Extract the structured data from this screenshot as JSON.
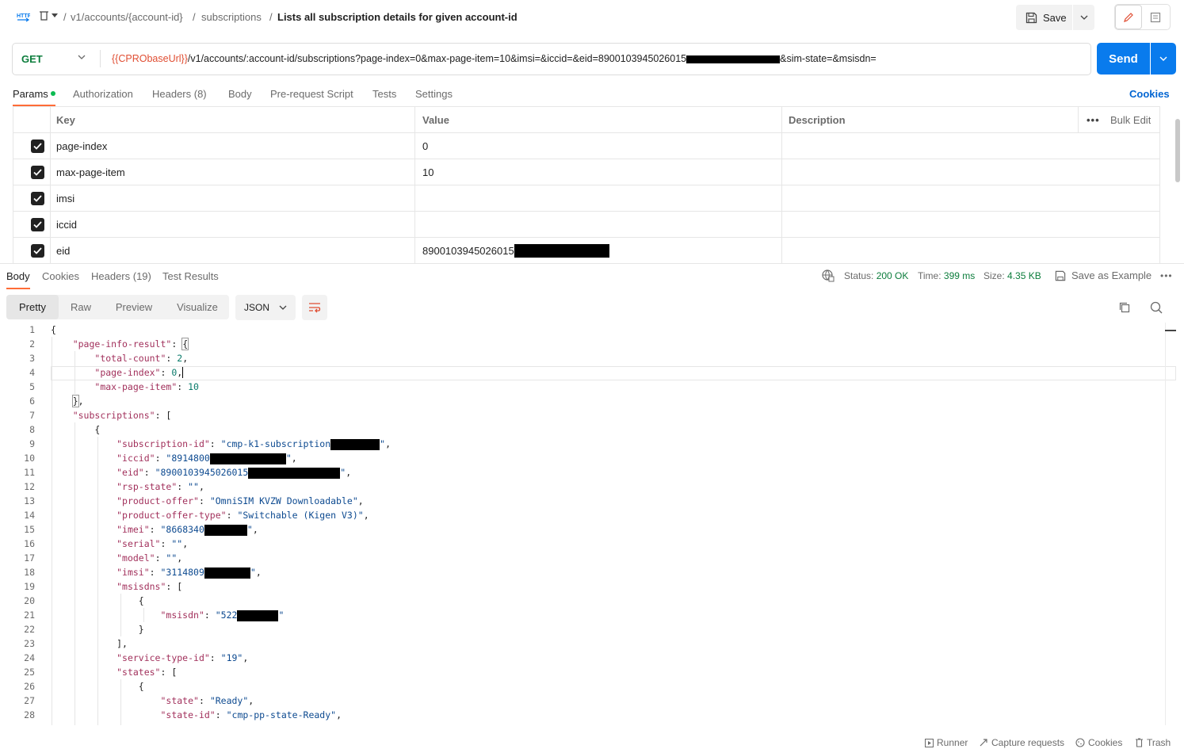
{
  "breadcrumb": {
    "part1": "v1/accounts/{account-id}",
    "part2": "subscriptions",
    "current": "Lists all subscription details for given account-id"
  },
  "toolbar": {
    "save_label": "Save"
  },
  "request": {
    "method": "GET",
    "url_variable": "{{CPRObaseUrl}}",
    "url_rest": "/v1/accounts/:account-id/subscriptions?page-index=0&max-page-item=10&imsi=&iccid=&eid=8900103945026015",
    "url_tail": "&sim-state=&msisdn=",
    "send_label": "Send"
  },
  "request_tabs": [
    "Params",
    "Authorization",
    "Headers (8)",
    "Body",
    "Pre-request Script",
    "Tests",
    "Settings"
  ],
  "cookies_link": "Cookies",
  "params_table": {
    "headers": {
      "key": "Key",
      "value": "Value",
      "description": "Description",
      "bulk_edit": "Bulk Edit"
    },
    "rows": [
      {
        "key": "page-index",
        "value": "0",
        "checked": true
      },
      {
        "key": "max-page-item",
        "value": "10",
        "checked": true
      },
      {
        "key": "imsi",
        "value": "",
        "checked": true
      },
      {
        "key": "iccid",
        "value": "",
        "checked": true
      },
      {
        "key": "eid",
        "value": "8900103945026015",
        "checked": true
      }
    ]
  },
  "response_tabs": [
    "Body",
    "Cookies",
    "Headers (19)",
    "Test Results"
  ],
  "response_status": {
    "status_label": "Status:",
    "status": "200 OK",
    "time_label": "Time:",
    "time": "399 ms",
    "size_label": "Size:",
    "size": "4.35 KB",
    "save_example": "Save as Example"
  },
  "view_modes": [
    "Pretty",
    "Raw",
    "Preview",
    "Visualize"
  ],
  "format": "JSON",
  "code_lines": [
    "1",
    "2",
    "3",
    "4",
    "5",
    "6",
    "7",
    "8",
    "9",
    "10",
    "11",
    "12",
    "13",
    "14",
    "15",
    "16",
    "17",
    "18",
    "19",
    "20",
    "21",
    "22",
    "23",
    "24",
    "25",
    "26",
    "27",
    "28"
  ],
  "json": {
    "page_info_key": "\"page-info-result\"",
    "total_count_key": "\"total-count\"",
    "total_count": "2",
    "page_index_key": "\"page-index\"",
    "page_index": "0",
    "max_page_item_key": "\"max-page-item\"",
    "max_page_item": "10",
    "subscriptions_key": "\"subscriptions\"",
    "subscription_id_key": "\"subscription-id\"",
    "subscription_id": "\"cmp-k1-subscription",
    "iccid_key": "\"iccid\"",
    "iccid": "\"8914800",
    "eid_key": "\"eid\"",
    "eid": "\"8900103945026015",
    "rsp_state_key": "\"rsp-state\"",
    "rsp_state": "\"\"",
    "product_offer_key": "\"product-offer\"",
    "product_offer": "\"OmniSIM KVZW Downloadable\"",
    "product_offer_type_key": "\"product-offer-type\"",
    "product_offer_type": "\"Switchable (Kigen V3)\"",
    "imei_key": "\"imei\"",
    "imei": "\"8668340",
    "serial_key": "\"serial\"",
    "serial": "\"\"",
    "model_key": "\"model\"",
    "model": "\"\"",
    "imsi_key": "\"imsi\"",
    "imsi": "\"3114809",
    "msisdns_key": "\"msisdns\"",
    "msisdn_key": "\"msisdn\"",
    "msisdn": "\"522",
    "service_type_id_key": "\"service-type-id\"",
    "service_type_id": "\"19\"",
    "states_key": "\"states\"",
    "state_key": "\"state\"",
    "state": "\"Ready\"",
    "state_id_key": "\"state-id\"",
    "state_id": "\"cmp-pp-state-Ready\""
  },
  "footer": [
    "Runner",
    "Capture requests",
    "Cookies",
    "Trash"
  ]
}
